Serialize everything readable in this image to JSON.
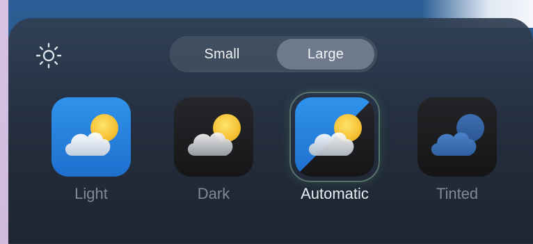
{
  "header": {
    "brightness_icon": "sun-icon"
  },
  "size_selector": {
    "options": [
      "Small",
      "Large"
    ],
    "selected": "Large"
  },
  "appearance": {
    "options": [
      {
        "label": "Light",
        "icon": "weather-light-icon"
      },
      {
        "label": "Dark",
        "icon": "weather-dark-icon"
      },
      {
        "label": "Automatic",
        "icon": "weather-automatic-icon"
      },
      {
        "label": "Tinted",
        "icon": "weather-tinted-icon"
      }
    ],
    "selected": "Automatic"
  },
  "colors": {
    "light_tile": "#2d8ae6",
    "dark_tile": "#1b1b1e",
    "sun": "#f5c93b",
    "tinted_cloud": "#3a6fb5"
  }
}
